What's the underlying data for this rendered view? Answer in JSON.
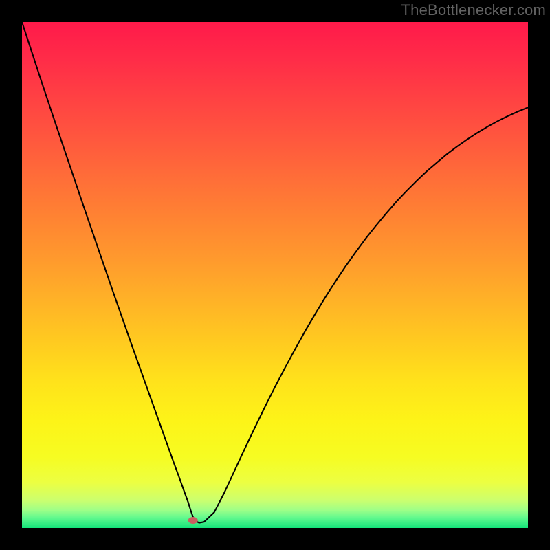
{
  "watermark": "TheBottlenecker.com",
  "chart_data": {
    "type": "line",
    "title": "",
    "xlabel": "",
    "ylabel": "",
    "xlim": [
      0,
      100
    ],
    "ylim": [
      0,
      100
    ],
    "grid": false,
    "background_gradient": [
      {
        "stop": 0.0,
        "color": "#ff1a4a"
      },
      {
        "stop": 0.07,
        "color": "#ff2b48"
      },
      {
        "stop": 0.15,
        "color": "#ff4143"
      },
      {
        "stop": 0.23,
        "color": "#ff573e"
      },
      {
        "stop": 0.31,
        "color": "#ff6e38"
      },
      {
        "stop": 0.39,
        "color": "#ff8432"
      },
      {
        "stop": 0.47,
        "color": "#ff9a2d"
      },
      {
        "stop": 0.55,
        "color": "#ffb227"
      },
      {
        "stop": 0.63,
        "color": "#ffca20"
      },
      {
        "stop": 0.71,
        "color": "#ffe21b"
      },
      {
        "stop": 0.79,
        "color": "#fdf418"
      },
      {
        "stop": 0.86,
        "color": "#f6fc22"
      },
      {
        "stop": 0.91,
        "color": "#ecff42"
      },
      {
        "stop": 0.945,
        "color": "#ccff6e"
      },
      {
        "stop": 0.965,
        "color": "#9dff88"
      },
      {
        "stop": 0.98,
        "color": "#60f98e"
      },
      {
        "stop": 1.0,
        "color": "#13e37a"
      }
    ],
    "marker": {
      "x": 33.8,
      "y": 1.5,
      "color": "#c86060",
      "rx": 7,
      "ry": 5
    },
    "series": [
      {
        "name": "bottleneck-curve",
        "color": "#000000",
        "width": 2.1,
        "x": [
          0,
          2,
          4,
          6,
          8,
          10,
          12,
          14,
          16,
          18,
          20,
          22,
          24,
          26,
          28,
          30,
          31,
          32,
          32.8,
          33.4,
          34,
          35,
          36,
          38,
          40,
          42,
          44,
          46,
          48,
          50,
          52,
          54,
          56,
          58,
          60,
          62,
          64,
          66,
          68,
          70,
          72,
          74,
          76,
          78,
          80,
          82,
          84,
          86,
          88,
          90,
          92,
          94,
          96,
          98,
          100
        ],
        "y": [
          100,
          93.9,
          87.8,
          81.8,
          75.9,
          70.0,
          64.1,
          58.3,
          52.5,
          46.7,
          41.0,
          35.3,
          29.7,
          24.1,
          18.5,
          12.9,
          10.2,
          7.4,
          5.2,
          3.3,
          1.6,
          1.0,
          1.2,
          3.1,
          7.0,
          11.3,
          15.6,
          19.8,
          23.9,
          27.9,
          31.7,
          35.4,
          39.0,
          42.4,
          45.7,
          48.8,
          51.8,
          54.6,
          57.3,
          59.8,
          62.2,
          64.5,
          66.6,
          68.6,
          70.5,
          72.2,
          73.9,
          75.4,
          76.8,
          78.1,
          79.3,
          80.4,
          81.4,
          82.3,
          83.1
        ]
      }
    ]
  }
}
